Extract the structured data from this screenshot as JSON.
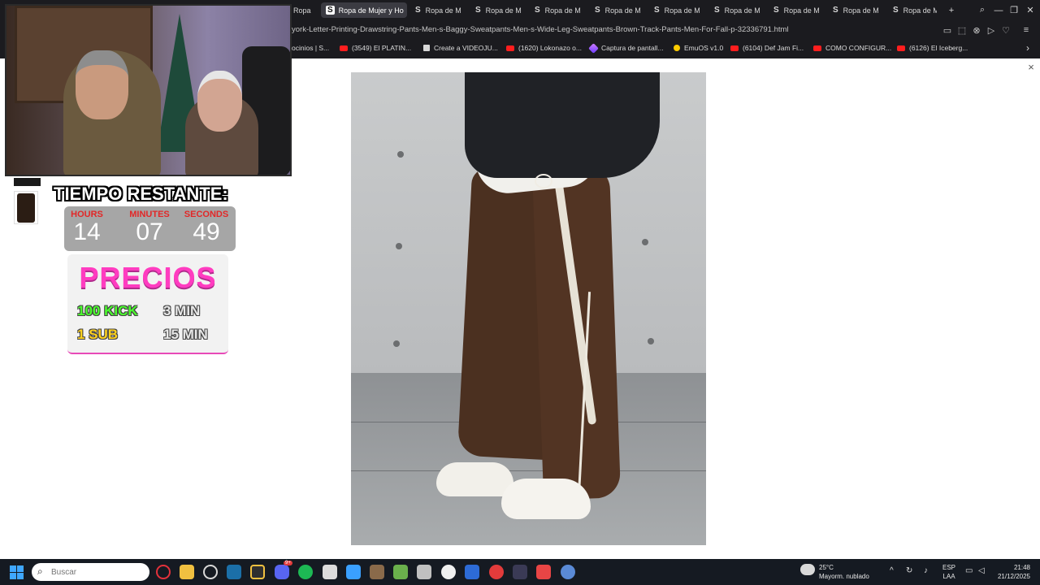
{
  "browser": {
    "tabs": [
      {
        "icon": "S",
        "label": "Ropa de M",
        "active": false,
        "partial": true
      },
      {
        "icon": "S",
        "label": "Ropa de Mujer y Ho",
        "active": true
      },
      {
        "icon": "S",
        "label": "Ropa de M",
        "active": false
      },
      {
        "icon": "S",
        "label": "Ropa de M",
        "active": false
      },
      {
        "icon": "S",
        "label": "Ropa de M",
        "active": false
      },
      {
        "icon": "S",
        "label": "Ropa de M",
        "active": false
      },
      {
        "icon": "S",
        "label": "Ropa de M",
        "active": false
      },
      {
        "icon": "S",
        "label": "Ropa de M",
        "active": false
      },
      {
        "icon": "S",
        "label": "Ropa de M",
        "active": false
      },
      {
        "icon": "S",
        "label": "Ropa de M",
        "active": false
      },
      {
        "icon": "S",
        "label": "Ropa de M",
        "active": false
      }
    ],
    "new_tab_glyph": "+",
    "window_controls": {
      "search": "⌕",
      "minimize": "—",
      "restore": "❐",
      "close": "✕"
    },
    "url": "york-Letter-Printing-Drawstring-Pants-Men-s-Baggy-Sweatpants-Men-s-Wide-Leg-Sweatpants-Brown-Track-Pants-Men-For-Fall-p-32336791.html",
    "bookmarks": [
      {
        "icon": "none",
        "label": "ocinios | S..."
      },
      {
        "icon": "youtube",
        "label": "(3549) El PLATIN..."
      },
      {
        "icon": "generic",
        "label": "Create a VIDEOJU..."
      },
      {
        "icon": "youtube",
        "label": "(1620) Lokonazo o..."
      },
      {
        "icon": "pen",
        "label": "Captura de pantall..."
      },
      {
        "icon": "emu",
        "label": "EmuOS v1.0"
      },
      {
        "icon": "youtube",
        "label": "(6104) Def Jam Fi..."
      },
      {
        "icon": "youtube",
        "label": "COMO CONFIGUR..."
      },
      {
        "icon": "youtube",
        "label": "(6126) El Iceberg..."
      }
    ],
    "bookmarks_more": "›"
  },
  "page": {
    "close_glyph": "×"
  },
  "overlay": {
    "timer_title": "TIEMPO RESTANTE:",
    "countdown": [
      {
        "label": "HOURS",
        "value": "14"
      },
      {
        "label": "MINUTES",
        "value": "07"
      },
      {
        "label": "SECONDS",
        "value": "49"
      }
    ],
    "prices_title": "PRECIOS",
    "prices": [
      {
        "item": "100 KICK",
        "time": "3 MIN",
        "color": "#4cff2e"
      },
      {
        "item": "1 SUB",
        "time": "15 MIN",
        "color": "#ffd21f"
      }
    ]
  },
  "taskbar": {
    "search_placeholder": "Buscar",
    "weather_temp": "25°C",
    "weather_desc": "Mayorm. nublado",
    "lang_top": "ESP",
    "lang_bottom": "LAA",
    "time": "21:48",
    "date": "21/12/2025",
    "discord_badge": "9+"
  }
}
